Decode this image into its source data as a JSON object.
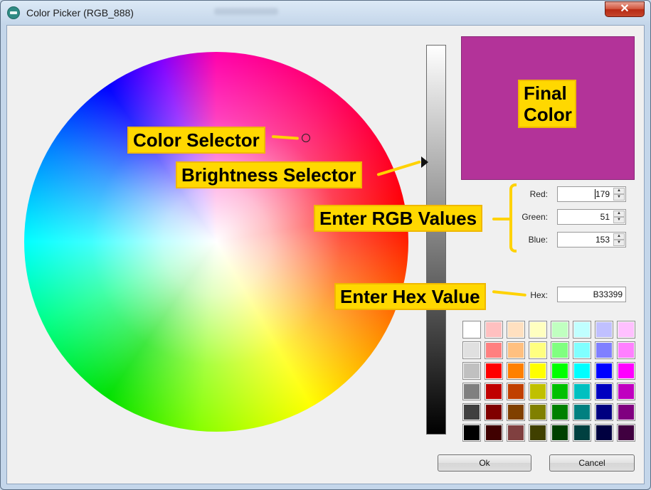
{
  "window": {
    "title": "Color Picker (RGB_888)",
    "close_glyph": "✕",
    "icon": "app-icon"
  },
  "color": {
    "hex_color": "#b33399"
  },
  "rgb": {
    "red_label": "Red:",
    "red_value": "179",
    "green_label": "Green:",
    "green_value": "51",
    "blue_label": "Blue:",
    "blue_value": "153"
  },
  "hex": {
    "label": "Hex:",
    "value": "B33399"
  },
  "palette": [
    [
      "#ffffff",
      "#ffc0c0",
      "#ffe0c0",
      "#ffffc0",
      "#c0ffc0",
      "#c0ffff",
      "#c0c0ff",
      "#ffc0ff"
    ],
    [
      "#e0e0e0",
      "#ff8080",
      "#ffc080",
      "#ffff80",
      "#80ff80",
      "#80ffff",
      "#8080ff",
      "#ff80ff"
    ],
    [
      "#c0c0c0",
      "#ff0000",
      "#ff8000",
      "#ffff00",
      "#00ff00",
      "#00ffff",
      "#0000ff",
      "#ff00ff"
    ],
    [
      "#808080",
      "#c00000",
      "#c04000",
      "#c0c000",
      "#00c000",
      "#00c0c0",
      "#0000c0",
      "#c000c0"
    ],
    [
      "#404040",
      "#800000",
      "#804000",
      "#808000",
      "#008000",
      "#008080",
      "#000080",
      "#800080"
    ],
    [
      "#000000",
      "#400000",
      "#804040",
      "#404000",
      "#004000",
      "#004040",
      "#000040",
      "#400040"
    ]
  ],
  "buttons": {
    "ok": "Ok",
    "cancel": "Cancel"
  },
  "annotations": {
    "color_selector": "Color Selector",
    "brightness_selector": "Brightness Selector",
    "final_color": "Final Color",
    "enter_rgb": "Enter RGB Values",
    "enter_hex": "Enter Hex Value"
  },
  "colors": {
    "annotation_fill": "#ffd800",
    "annotation_border": "#f0b800"
  }
}
